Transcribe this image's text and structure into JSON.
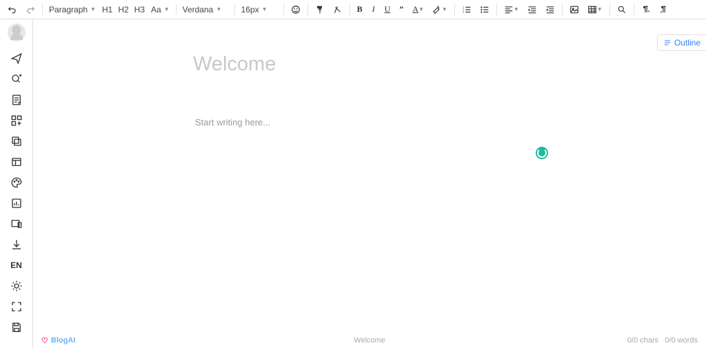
{
  "toolbar": {
    "paragraph_label": "Paragraph",
    "headings": [
      "H1",
      "H2",
      "H3"
    ],
    "case_label": "Aa",
    "font_family": "Verdana",
    "font_size": "16px"
  },
  "sidebar": {
    "lang": "EN"
  },
  "editor": {
    "title_placeholder": "Welcome",
    "body_placeholder": "Start writing here..."
  },
  "outline": {
    "label": "Outline"
  },
  "footer": {
    "brand": "BlogAI",
    "doc_name": "Welcome",
    "chars_count": "0/0",
    "chars_label": "chars",
    "words_count": "0/0",
    "words_label": "words"
  }
}
